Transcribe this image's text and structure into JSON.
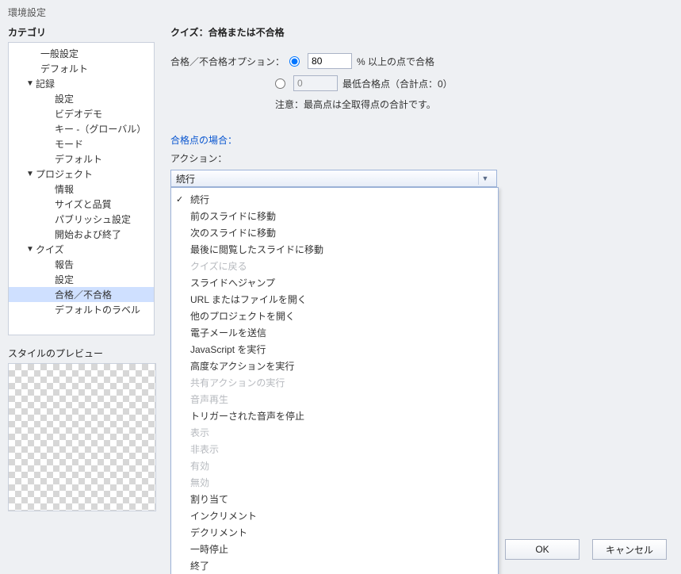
{
  "window_title": "環境設定",
  "category_label": "カテゴリ",
  "preview_label": "スタイルのプレビュー",
  "tree": {
    "items": [
      {
        "label": "一般設定",
        "depth": 0
      },
      {
        "label": "デフォルト",
        "depth": 0
      },
      {
        "label": "記録",
        "depth": 0,
        "parent": true,
        "expanded": true
      },
      {
        "label": "設定",
        "depth": 1
      },
      {
        "label": "ビデオデモ",
        "depth": 1
      },
      {
        "label": "キー -（グローバル）",
        "depth": 1
      },
      {
        "label": "モード",
        "depth": 1
      },
      {
        "label": "デフォルト",
        "depth": 1
      },
      {
        "label": "プロジェクト",
        "depth": 0,
        "parent": true,
        "expanded": true
      },
      {
        "label": "情報",
        "depth": 1
      },
      {
        "label": "サイズと品質",
        "depth": 1
      },
      {
        "label": "パブリッシュ設定",
        "depth": 1
      },
      {
        "label": "開始および終了",
        "depth": 1
      },
      {
        "label": "クイズ",
        "depth": 0,
        "parent": true,
        "expanded": true
      },
      {
        "label": "報告",
        "depth": 1
      },
      {
        "label": "設定",
        "depth": 1
      },
      {
        "label": "合格／不合格",
        "depth": 1,
        "selected": true
      },
      {
        "label": "デフォルトのラベル",
        "depth": 1
      }
    ]
  },
  "main": {
    "title": "クイズ：合格または不合格",
    "option_label": "合格／不合格オプション：",
    "percent_value": "80",
    "percent_suffix": "% 以上の点で合格",
    "min_value": "0",
    "min_suffix": "最低合格点（合計点：0）",
    "note": "注意：最高点は全取得点の合計です。",
    "pass_case": "合格点の場合：",
    "action_label": "アクション：",
    "dd_selected": "続行",
    "dd_items": [
      {
        "label": "続行",
        "checked": true
      },
      {
        "label": "前のスライドに移動"
      },
      {
        "label": "次のスライドに移動"
      },
      {
        "label": "最後に閲覧したスライドに移動"
      },
      {
        "label": "クイズに戻る",
        "disabled": true
      },
      {
        "label": "スライドへジャンプ"
      },
      {
        "label": "URL またはファイルを開く"
      },
      {
        "label": "他のプロジェクトを開く"
      },
      {
        "label": "電子メールを送信"
      },
      {
        "label": "JavaScript を実行"
      },
      {
        "label": "高度なアクションを実行"
      },
      {
        "label": "共有アクションの実行",
        "disabled": true
      },
      {
        "label": "音声再生",
        "disabled": true
      },
      {
        "label": "トリガーされた音声を停止"
      },
      {
        "label": "表示",
        "disabled": true
      },
      {
        "label": "非表示",
        "disabled": true
      },
      {
        "label": "有効",
        "disabled": true
      },
      {
        "label": "無効",
        "disabled": true
      },
      {
        "label": "割り当て"
      },
      {
        "label": "インクリメント"
      },
      {
        "label": "デクリメント"
      },
      {
        "label": "一時停止"
      },
      {
        "label": "終了"
      }
    ]
  },
  "buttons": {
    "ok": "OK",
    "cancel": "キャンセル"
  }
}
